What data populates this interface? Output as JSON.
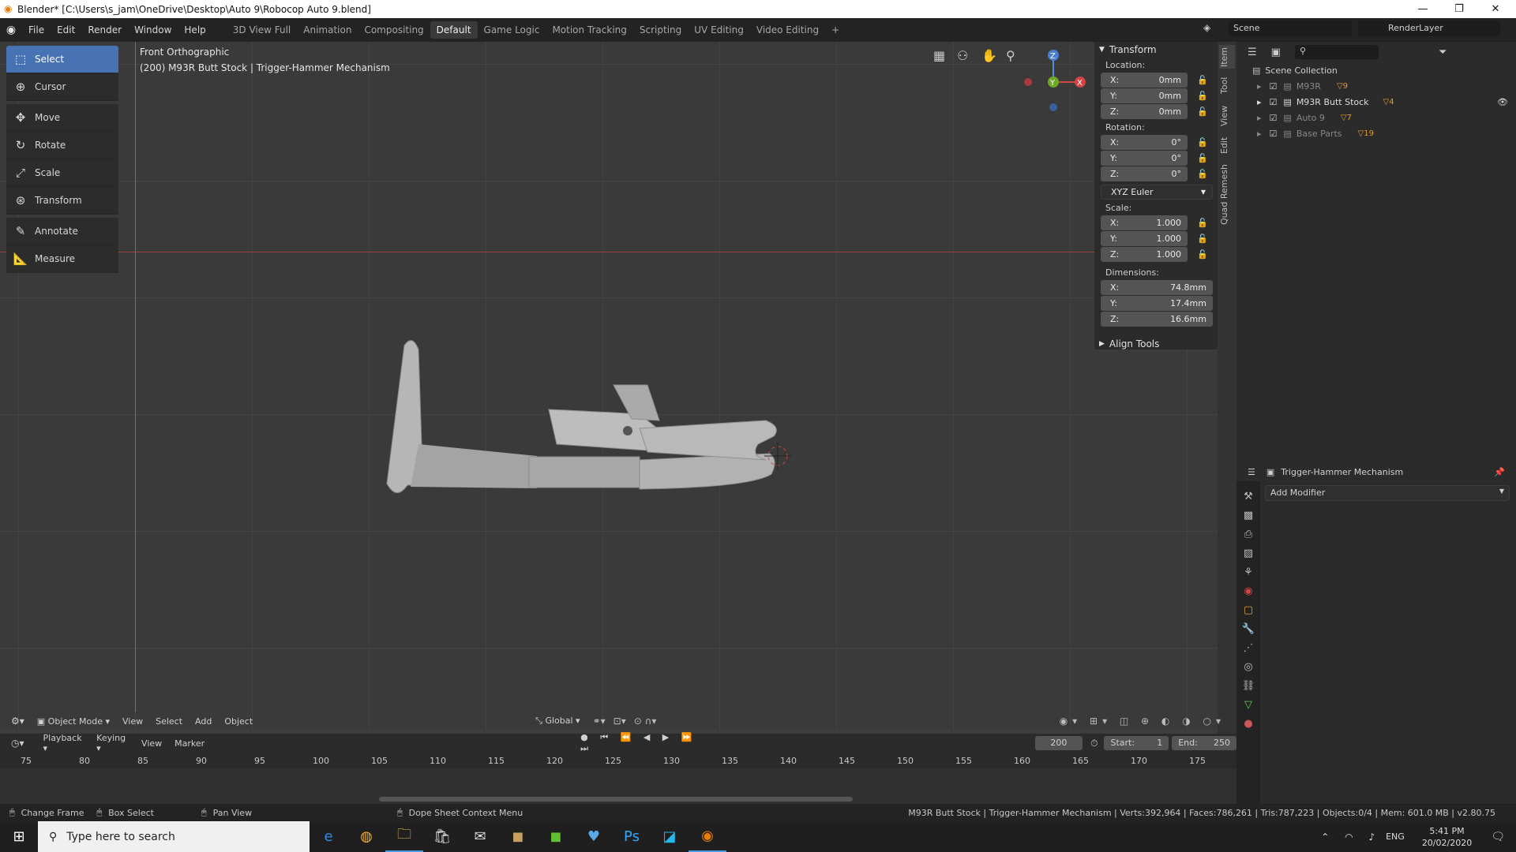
{
  "window": {
    "title": "Blender* [C:\\Users\\s_jam\\OneDrive\\Desktop\\Auto 9\\Robocop Auto 9.blend]"
  },
  "menu": [
    "File",
    "Edit",
    "Render",
    "Window",
    "Help"
  ],
  "workspaces": [
    "3D View Full",
    "Animation",
    "Compositing",
    "Default",
    "Game Logic",
    "Motion Tracking",
    "Scripting",
    "UV Editing",
    "Video Editing"
  ],
  "active_workspace": "Default",
  "scene": {
    "name": "Scene",
    "render_layer": "RenderLayer"
  },
  "viewport": {
    "view_name": "Front Orthographic",
    "object_info": "(200) M93R Butt Stock | Trigger-Hammer Mechanism"
  },
  "tools": [
    "Select",
    "Cursor",
    "Move",
    "Rotate",
    "Scale",
    "Transform",
    "Annotate",
    "Measure"
  ],
  "npanel": {
    "title": "Transform",
    "location_label": "Location:",
    "location": {
      "x": "0mm",
      "y": "0mm",
      "z": "0mm"
    },
    "rotation_label": "Rotation:",
    "rotation": {
      "x": "0°",
      "y": "0°",
      "z": "0°"
    },
    "rotation_mode": "XYZ Euler",
    "scale_label": "Scale:",
    "scale": {
      "x": "1.000",
      "y": "1.000",
      "z": "1.000"
    },
    "dimensions_label": "Dimensions:",
    "dimensions": {
      "x": "74.8mm",
      "y": "17.4mm",
      "z": "16.6mm"
    },
    "align_tools": "Align Tools"
  },
  "vtabs": [
    "Item",
    "Tool",
    "View",
    "Edit",
    "Quad Remesh"
  ],
  "outliner": {
    "root": "Scene Collection",
    "items": [
      {
        "name": "M93R",
        "count": "9"
      },
      {
        "name": "M93R Butt Stock",
        "count": "4"
      },
      {
        "name": "Auto 9",
        "count": "7"
      },
      {
        "name": "Base Parts",
        "count": "19"
      }
    ]
  },
  "properties": {
    "object": "Trigger-Hammer Mechanism",
    "add_modifier": "Add Modifier"
  },
  "viewport_header": {
    "mode": "Object Mode",
    "menus": [
      "View",
      "Select",
      "Add",
      "Object"
    ],
    "orientation": "Global"
  },
  "timeline": {
    "menus": [
      "Playback",
      "Keying",
      "View",
      "Marker"
    ],
    "current_frame": "200",
    "start_label": "Start:",
    "start": "1",
    "end_label": "End:",
    "end": "250",
    "ticks": [
      "75",
      "80",
      "85",
      "90",
      "95",
      "100",
      "105",
      "110",
      "115",
      "120",
      "125",
      "130",
      "135",
      "140",
      "145",
      "150",
      "155",
      "160",
      "165",
      "170",
      "175"
    ]
  },
  "status": {
    "left": [
      "Change Frame",
      "Box Select",
      "Pan View",
      "Dope Sheet Context Menu"
    ],
    "right": "M93R Butt Stock | Trigger-Hammer Mechanism | Verts:392,964 | Faces:786,261 | Tris:787,223 | Objects:0/4 | Mem: 601.0 MB | v2.80.75"
  },
  "taskbar": {
    "search_placeholder": "Type here to search",
    "lang": "ENG",
    "time": "5:41 PM",
    "date": "20/02/2020"
  }
}
